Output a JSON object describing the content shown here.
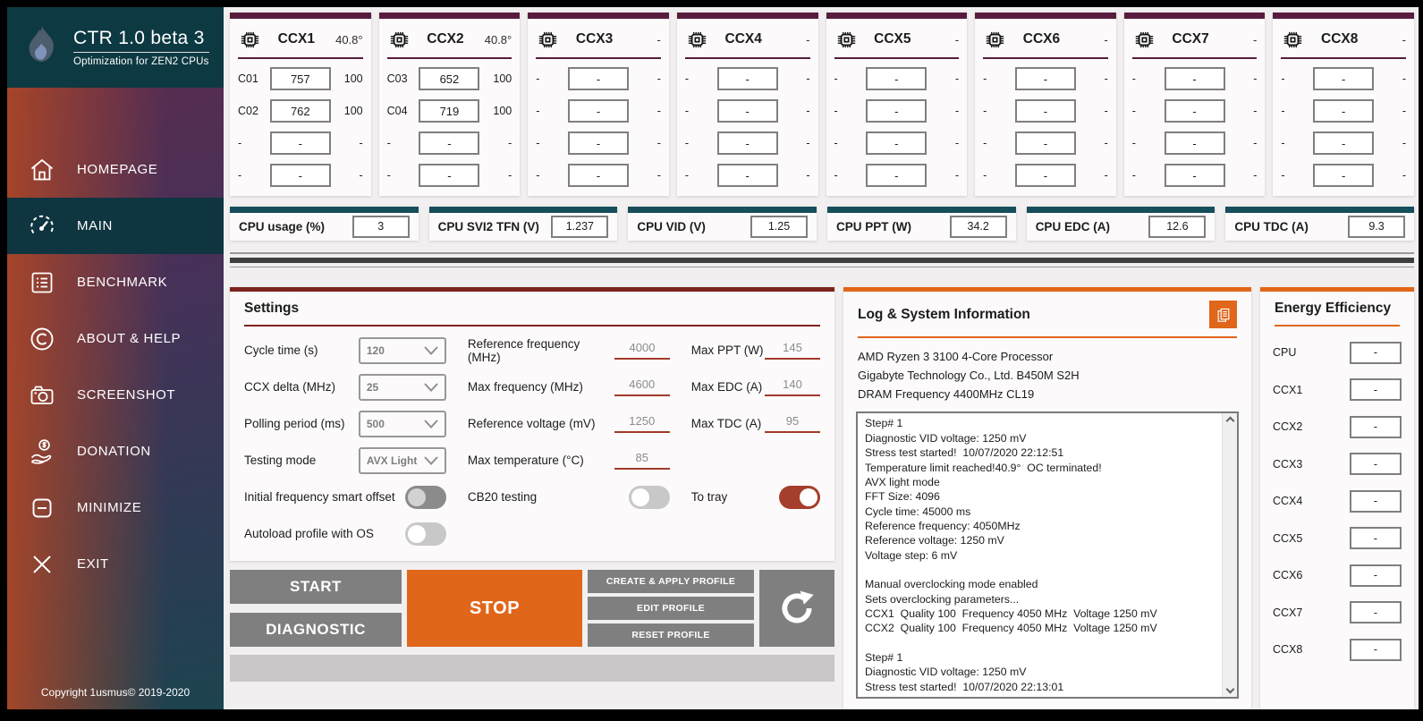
{
  "colors": {
    "accent_maroon": "#571c3e",
    "accent_teal": "#164e5b",
    "accent_red": "#7c231d",
    "accent_orange": "#e0661a",
    "toggle_red": "#a53e2c",
    "sidebar_teal": "#0d3942",
    "selected_teal": "#0f3540",
    "button_gray": "#7f7f7f"
  },
  "app": {
    "title": "CTR 1.0 beta 3",
    "subtitle": "Optimization for ZEN2 CPUs",
    "copyright": "Copyright 1usmus© 2019-2020"
  },
  "sidebar": {
    "items": [
      {
        "id": "homepage",
        "label": "HOMEPAGE",
        "icon": "#i-home",
        "cls": ""
      },
      {
        "id": "main",
        "label": "MAIN",
        "icon": "#i-gauge",
        "cls": "selected"
      },
      {
        "id": "benchmark",
        "label": "BENCHMARK",
        "icon": "#i-list",
        "cls": ""
      },
      {
        "id": "about",
        "label": "ABOUT & HELP",
        "icon": "#i-copyright",
        "cls": ""
      },
      {
        "id": "screenshot",
        "label": "SCREENSHOT",
        "icon": "#i-camera",
        "cls": ""
      },
      {
        "id": "donation",
        "label": "DONATION",
        "icon": "#i-donate",
        "cls": ""
      },
      {
        "id": "minimize",
        "label": "MINIMIZE",
        "icon": "#i-minimize",
        "cls": ""
      },
      {
        "id": "exit",
        "label": "EXIT",
        "icon": "#i-exit",
        "cls": ""
      }
    ]
  },
  "ccx_panels": [
    {
      "id": "ccx1",
      "name": "CCX1",
      "temp": "40.8°",
      "rows": [
        {
          "label": "C01",
          "value": "757",
          "quality": "100"
        },
        {
          "label": "C02",
          "value": "762",
          "quality": "100"
        },
        {
          "label": "-",
          "value": "-",
          "quality": "-"
        },
        {
          "label": "-",
          "value": "-",
          "quality": "-"
        }
      ]
    },
    {
      "id": "ccx2",
      "name": "CCX2",
      "temp": "40.8°",
      "rows": [
        {
          "label": "C03",
          "value": "652",
          "quality": "100"
        },
        {
          "label": "C04",
          "value": "719",
          "quality": "100"
        },
        {
          "label": "-",
          "value": "-",
          "quality": "-"
        },
        {
          "label": "-",
          "value": "-",
          "quality": "-"
        }
      ]
    },
    {
      "id": "ccx3",
      "name": "CCX3",
      "temp": "-",
      "rows": [
        {
          "label": "-",
          "value": "-",
          "quality": "-"
        },
        {
          "label": "-",
          "value": "-",
          "quality": "-"
        },
        {
          "label": "-",
          "value": "-",
          "quality": "-"
        },
        {
          "label": "-",
          "value": "-",
          "quality": "-"
        }
      ]
    },
    {
      "id": "ccx4",
      "name": "CCX4",
      "temp": "-",
      "rows": [
        {
          "label": "-",
          "value": "-",
          "quality": "-"
        },
        {
          "label": "-",
          "value": "-",
          "quality": "-"
        },
        {
          "label": "-",
          "value": "-",
          "quality": "-"
        },
        {
          "label": "-",
          "value": "-",
          "quality": "-"
        }
      ]
    },
    {
      "id": "ccx5",
      "name": "CCX5",
      "temp": "-",
      "rows": [
        {
          "label": "-",
          "value": "-",
          "quality": "-"
        },
        {
          "label": "-",
          "value": "-",
          "quality": "-"
        },
        {
          "label": "-",
          "value": "-",
          "quality": "-"
        },
        {
          "label": "-",
          "value": "-",
          "quality": "-"
        }
      ]
    },
    {
      "id": "ccx6",
      "name": "CCX6",
      "temp": "-",
      "rows": [
        {
          "label": "-",
          "value": "-",
          "quality": "-"
        },
        {
          "label": "-",
          "value": "-",
          "quality": "-"
        },
        {
          "label": "-",
          "value": "-",
          "quality": "-"
        },
        {
          "label": "-",
          "value": "-",
          "quality": "-"
        }
      ]
    },
    {
      "id": "ccx7",
      "name": "CCX7",
      "temp": "-",
      "rows": [
        {
          "label": "-",
          "value": "-",
          "quality": "-"
        },
        {
          "label": "-",
          "value": "-",
          "quality": "-"
        },
        {
          "label": "-",
          "value": "-",
          "quality": "-"
        },
        {
          "label": "-",
          "value": "-",
          "quality": "-"
        }
      ]
    },
    {
      "id": "ccx8",
      "name": "CCX8",
      "temp": "-",
      "rows": [
        {
          "label": "-",
          "value": "-",
          "quality": "-"
        },
        {
          "label": "-",
          "value": "-",
          "quality": "-"
        },
        {
          "label": "-",
          "value": "-",
          "quality": "-"
        },
        {
          "label": "-",
          "value": "-",
          "quality": "-"
        }
      ]
    }
  ],
  "stats": [
    {
      "id": "cpu-usage",
      "label": "CPU usage (%)",
      "value": "3"
    },
    {
      "id": "cpu-svi2-tfn",
      "label": "CPU SVI2 TFN (V)",
      "value": "1.237"
    },
    {
      "id": "cpu-vid",
      "label": "CPU VID (V)",
      "value": "1.25"
    },
    {
      "id": "cpu-ppt",
      "label": "CPU PPT (W)",
      "value": "34.2"
    },
    {
      "id": "cpu-edc",
      "label": "CPU EDC (A)",
      "value": "12.6"
    },
    {
      "id": "cpu-tdc",
      "label": "CPU TDC (A)",
      "value": "9.3"
    }
  ],
  "settings": {
    "title": "Settings",
    "dropdowns": [
      {
        "label": "Cycle time (s)",
        "value": "120"
      },
      {
        "label": "CCX delta (MHz)",
        "value": "25"
      },
      {
        "label": "Polling period (ms)",
        "value": "500"
      },
      {
        "label": "Testing mode",
        "value": "AVX Light"
      }
    ],
    "inputs_mid": [
      {
        "label": "Reference frequency (MHz)",
        "value": "4000"
      },
      {
        "label": "Max frequency (MHz)",
        "value": "4600"
      },
      {
        "label": "Reference voltage (mV)",
        "value": "1250"
      },
      {
        "label": "Max temperature (°C)",
        "value": "85"
      }
    ],
    "inputs_right": [
      {
        "label": "Max PPT (W)",
        "value": "145"
      },
      {
        "label": "Max EDC (A)",
        "value": "140"
      },
      {
        "label": "Max TDC (A)",
        "value": "95"
      }
    ],
    "toggles": {
      "smart_offset": {
        "label": "Initial frequency smart offset",
        "state": "off",
        "cls": "t-off-dark"
      },
      "autoload": {
        "label": "Autoload profile with OS",
        "state": "off",
        "cls": "t-off-light"
      },
      "cb20": {
        "label": "CB20 testing",
        "state": "off",
        "cls": "t-off-light"
      },
      "to_tray": {
        "label": "To tray",
        "state": "on",
        "cls": "t-on-red"
      }
    },
    "buttons": {
      "start": "START",
      "diagnostic": "DIAGNOSTIC",
      "stop": "STOP",
      "profiles": [
        {
          "id": "create-apply-profile",
          "label": "CREATE & APPLY PROFILE"
        },
        {
          "id": "edit-profile",
          "label": "EDIT PROFILE"
        },
        {
          "id": "reset-profile",
          "label": "RESET PROFILE"
        }
      ]
    }
  },
  "log": {
    "title": "Log & System Information",
    "sysinfo": [
      "AMD Ryzen 3 3100 4-Core Processor",
      "Gigabyte Technology Co., Ltd. B450M S2H",
      "DRAM Frequency 4400MHz CL19"
    ],
    "lines": [
      "Step# 1",
      "Diagnostic VID voltage: 1250 mV",
      "Stress test started!  10/07/2020 22:12:51",
      "Temperature limit reached!40.9°  OC terminated!",
      "AVX light mode",
      "FFT Size: 4096",
      "Cycle time: 45000 ms",
      "Reference frequency: 4050MHz",
      "Reference voltage: 1250 mV",
      "Voltage step: 6 mV",
      "",
      "Manual overclocking mode enabled",
      "Sets overclocking parameters...",
      "CCX1  Quality 100  Frequency 4050 MHz  Voltage 1250 mV",
      "CCX2  Quality 100  Frequency 4050 MHz  Voltage 1250 mV",
      "",
      "Step# 1",
      "Diagnostic VID voltage: 1250 mV",
      "Stress test started!  10/07/2020 22:13:01"
    ]
  },
  "energy": {
    "title": "Energy Efficiency",
    "rows": [
      {
        "id": "cpu",
        "label": "CPU",
        "value": "-"
      },
      {
        "id": "ccx1",
        "label": "CCX1",
        "value": "-"
      },
      {
        "id": "ccx2",
        "label": "CCX2",
        "value": "-"
      },
      {
        "id": "ccx3",
        "label": "CCX3",
        "value": "-"
      },
      {
        "id": "ccx4",
        "label": "CCX4",
        "value": "-"
      },
      {
        "id": "ccx5",
        "label": "CCX5",
        "value": "-"
      },
      {
        "id": "ccx6",
        "label": "CCX6",
        "value": "-"
      },
      {
        "id": "ccx7",
        "label": "CCX7",
        "value": "-"
      },
      {
        "id": "ccx8",
        "label": "CCX8",
        "value": "-"
      }
    ]
  }
}
